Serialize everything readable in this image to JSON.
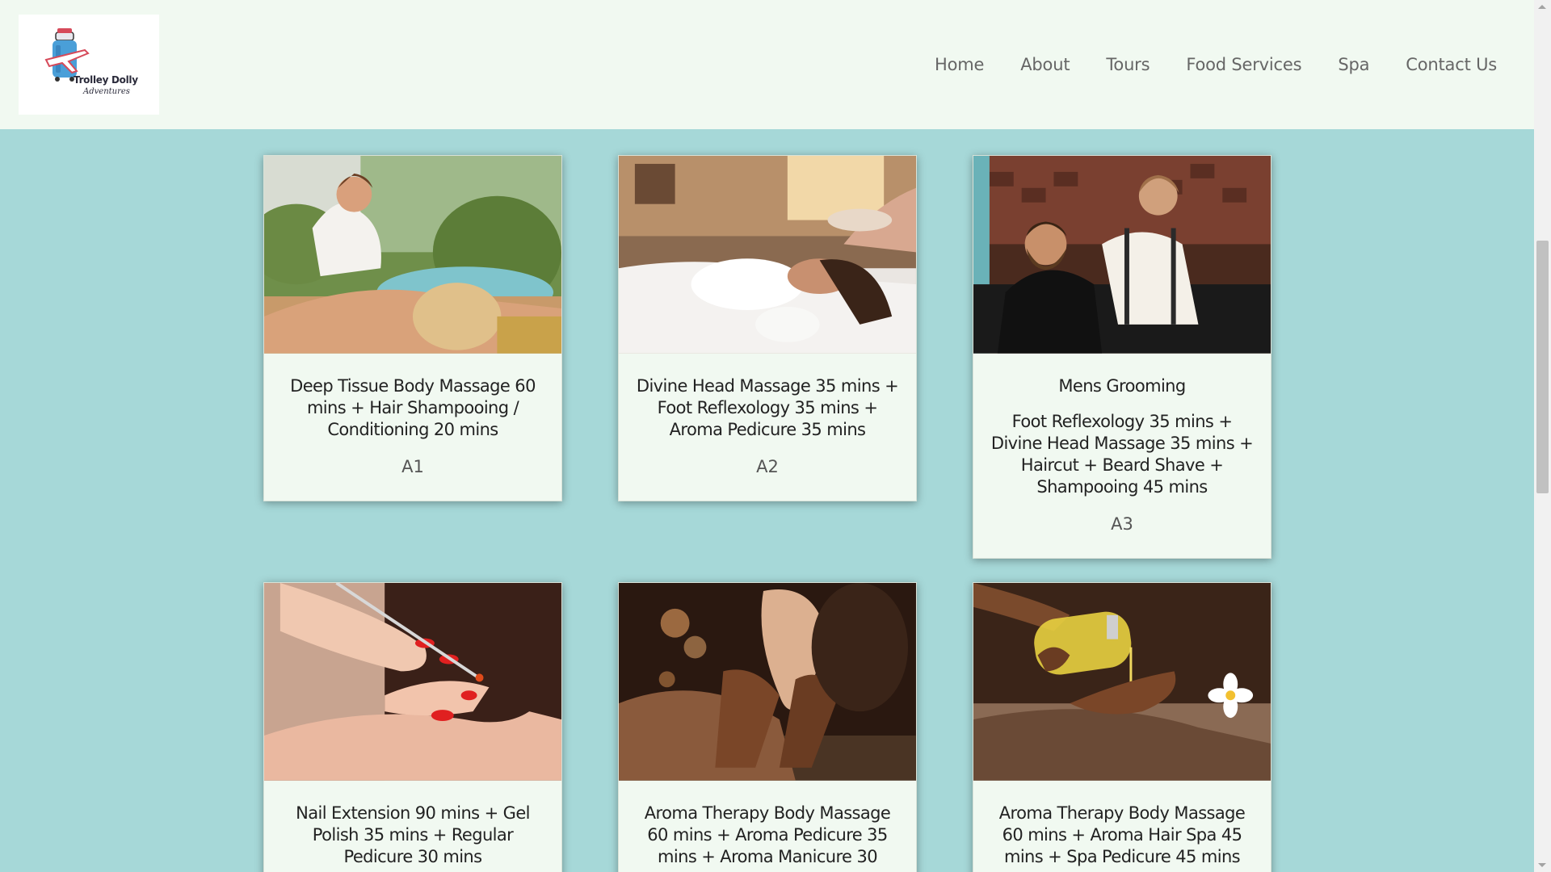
{
  "logo": {
    "line1": "Trolley Dolly",
    "line2": "Adventures"
  },
  "nav": [
    "Home",
    "About",
    "Tours",
    "Food Services",
    "Spa",
    "Contact Us"
  ],
  "packages": [
    {
      "title": "Deep Tissue Body Massage 60 mins + Hair Shampooing / Conditioning 20 mins",
      "code": "A1",
      "image": "massage-outdoor-photo"
    },
    {
      "title": "Divine Head Massage 35 mins + Foot Reflexology 35 mins + Aroma Pedicure 35 mins",
      "code": "A2",
      "image": "head-massage-photo"
    },
    {
      "title": "Mens Grooming",
      "description": "Foot Reflexology 35 mins + Divine Head Massage 35 mins + Haircut + Beard Shave + Shampooing 45 mins",
      "code": "A3",
      "image": "barber-photo"
    },
    {
      "title": "Nail Extension 90 mins + Gel Polish 35 mins + Regular Pedicure 30 mins",
      "image": "nail-polish-photo"
    },
    {
      "title": "Aroma Therapy Body Massage 60 mins + Aroma Pedicure 35 mins + Aroma Manicure 30",
      "image": "foot-massage-photo"
    },
    {
      "title": "Aroma Therapy Body Massage 60 mins + Aroma Hair Spa 45 mins + Spa Pedicure 45 mins",
      "image": "oil-massage-photo"
    }
  ]
}
